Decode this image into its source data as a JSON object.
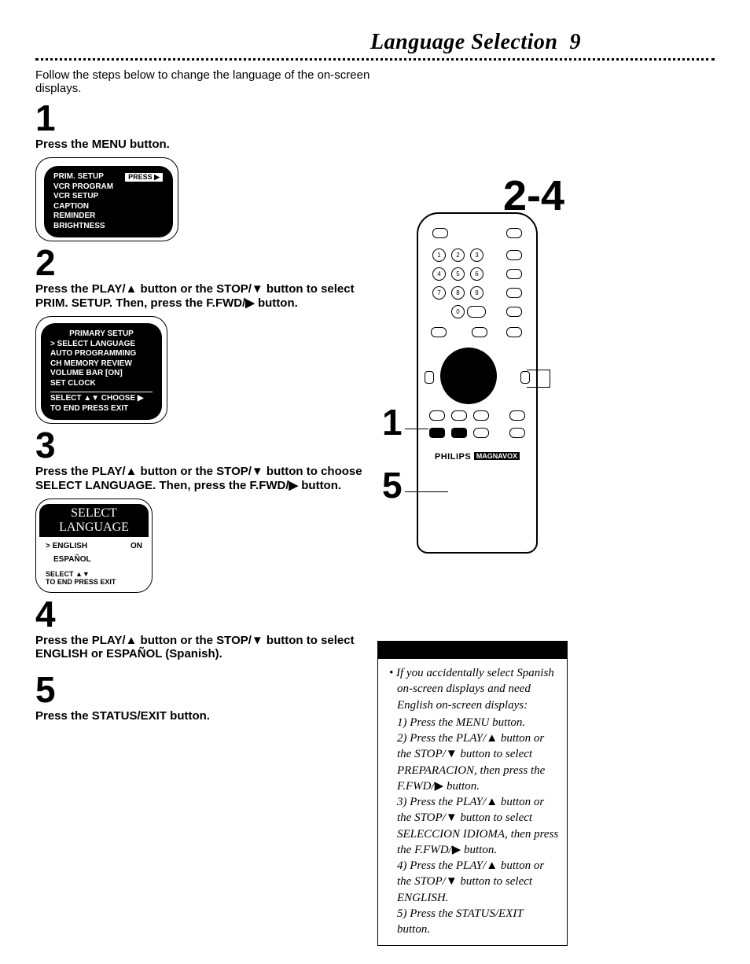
{
  "header": {
    "title": "Language Selection",
    "page": "9"
  },
  "intro": "Follow the steps below to change the language of the on-screen displays.",
  "steps": {
    "s1": {
      "num": "1",
      "text": "Press the MENU button.",
      "osd": {
        "items": [
          "PRIM. SETUP",
          "VCR PROGRAM",
          "VCR SETUP",
          "CAPTION",
          "REMINDER",
          "BRIGHTNESS"
        ],
        "press": "PRESS ▶"
      }
    },
    "s2": {
      "num": "2",
      "text_a": "Press the PLAY/",
      "text_b": " button or the STOP/",
      "text_c": " button to select PRIM. SETUP. Then, press the F.FWD/",
      "text_d": " button.",
      "osd": {
        "title": "PRIMARY SETUP",
        "items": [
          "SELECT LANGUAGE",
          "AUTO PROGRAMMING",
          "CH MEMORY REVIEW",
          "VOLUME BAR        [ON]",
          "SET CLOCK"
        ],
        "foot1": "SELECT ▲▼  CHOOSE ▶",
        "foot2": "TO  END  PRESS  EXIT"
      }
    },
    "s3": {
      "num": "3",
      "text_a": "Press the PLAY/",
      "text_b": " button or the STOP/",
      "text_c": " button to choose SELECT LANGUAGE. Then, press the F.FWD/",
      "text_d": " button.",
      "osd": {
        "title": "SELECT LANGUAGE",
        "row1_l": "> ENGLISH",
        "row1_r": "ON",
        "row2": "ESPAÑOL",
        "foot1": "SELECT ▲▼",
        "foot2": "TO  END  PRESS  EXIT"
      }
    },
    "s4": {
      "num": "4",
      "text_a": "Press the PLAY/",
      "text_b": " button or the STOP/",
      "text_c": " button to select ENGLISH or ESPAÑOL (Spanish)."
    },
    "s5": {
      "num": "5",
      "text": "Press the STATUS/EXIT button."
    }
  },
  "remote": {
    "callouts": {
      "a": "2-4",
      "b": "1",
      "c": "5"
    },
    "brand": {
      "a": "PHILIPS",
      "b": "MAGNAVOX"
    }
  },
  "hint": {
    "lead": "If you accidentally select Spanish on-screen displays and need English on-screen displays:",
    "l1": "1) Press the MENU button.",
    "l2a": "2) Press the PLAY/",
    "l2b": " button or the STOP/",
    "l2c": " button to select PREPARA­CION, then press the F.FWD/",
    "l2d": " button.",
    "l3a": "3) Press the PLAY/",
    "l3b": " button or the STOP/",
    "l3c": " button to select SELEC­CION IDIOMA, then press the F.FWD/",
    "l3d": " button.",
    "l4a": "4) Press the PLAY/",
    "l4b": " button or the STOP/",
    "l4c": " button to select ENGLISH.",
    "l5": "5) Press the STATUS/EXIT button."
  }
}
